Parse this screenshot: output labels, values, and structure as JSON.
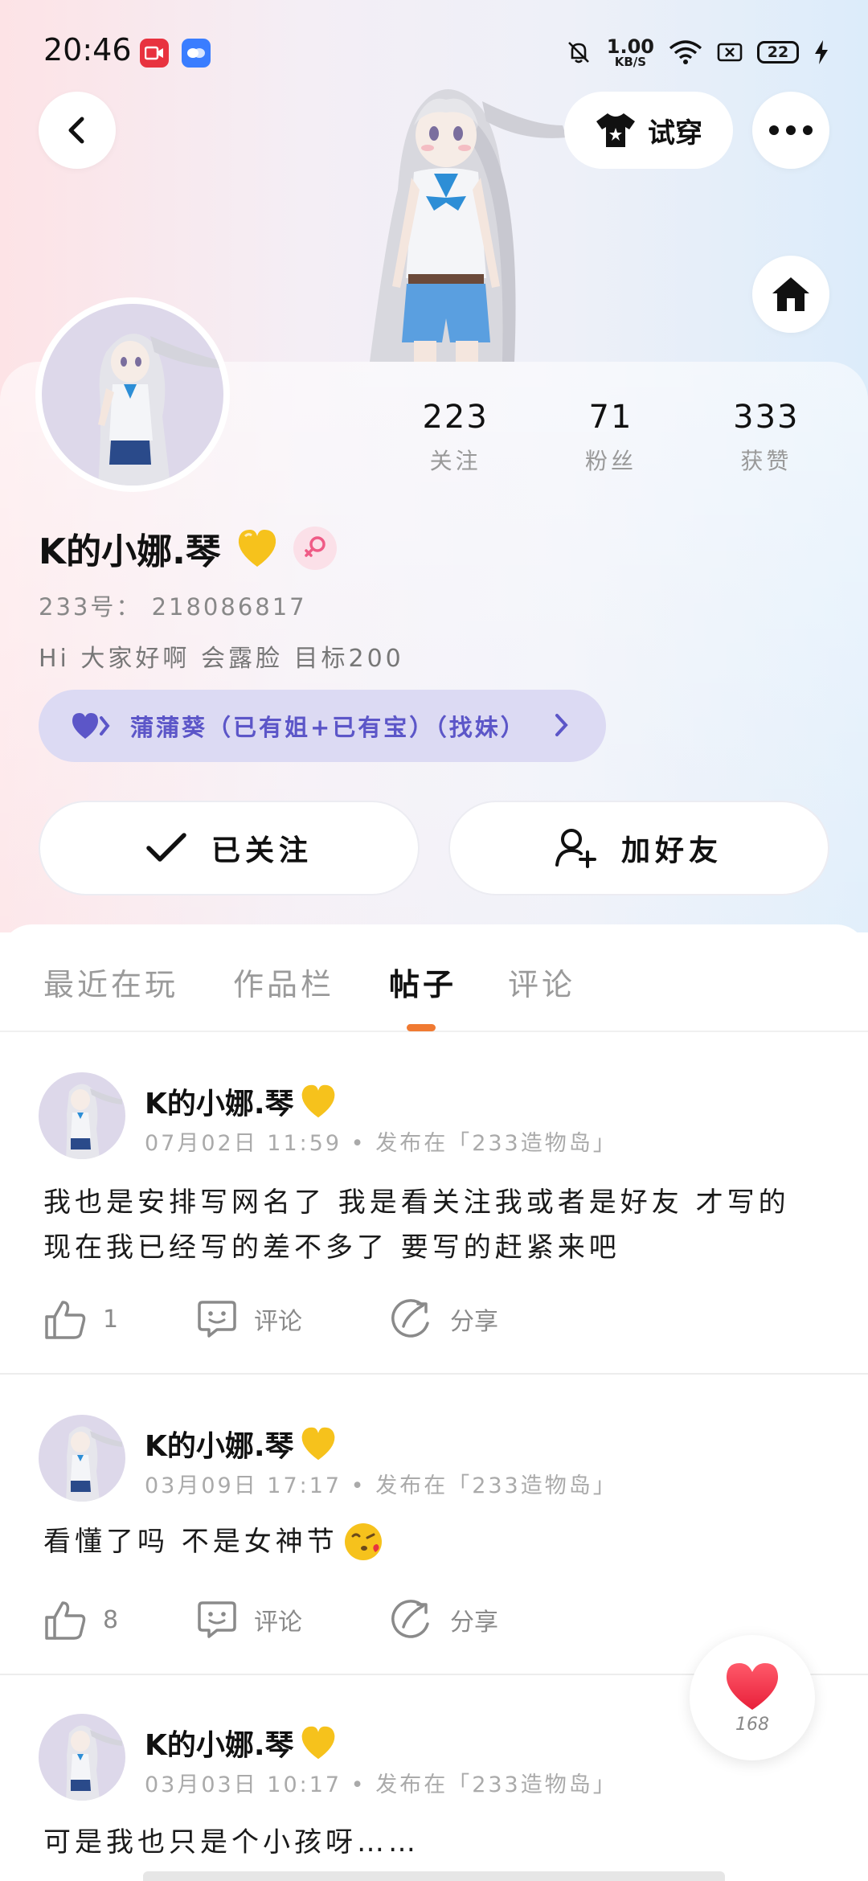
{
  "status_bar": {
    "time": "20:46",
    "net_speed_value": "1.00",
    "net_speed_unit": "KB/S",
    "battery": "22"
  },
  "header": {
    "try_on_label": "试穿"
  },
  "profile": {
    "name": "K的小娜.琴",
    "uid": "233号： 218086817",
    "bio": "Hi 大家好啊 会露脸 目标200",
    "tag": "蒲蒲葵（已有姐+已有宝）（找妹）"
  },
  "stats": [
    {
      "num": "223",
      "label": "关注"
    },
    {
      "num": "71",
      "label": "粉丝"
    },
    {
      "num": "333",
      "label": "获赞"
    }
  ],
  "actions": {
    "followed_label": "已关注",
    "add_friend_label": "加好友"
  },
  "tabs": [
    "最近在玩",
    "作品栏",
    "帖子",
    "评论"
  ],
  "posts": [
    {
      "author": "K的小娜.琴",
      "meta": "07月02日 11:59 • 发布在「233造物岛」",
      "text": "我也是安排写网名了 我是看关注我或者是好友 才写的 现在我已经写的差不多了 要写的赶紧来吧",
      "likes": "1",
      "comment_label": "评论",
      "share_label": "分享"
    },
    {
      "author": "K的小娜.琴",
      "meta": "03月09日 17:17 • 发布在「233造物岛」",
      "text": "看懂了吗 不是女神节",
      "likes": "8",
      "comment_label": "评论",
      "share_label": "分享"
    },
    {
      "author": "K的小娜.琴",
      "meta": "03月03日 10:17 • 发布在「233造物岛」",
      "text": "可是我也只是个小孩呀……"
    }
  ],
  "float_like": {
    "count": "168"
  },
  "colors": {
    "accent_orange": "#f07a32",
    "tag_purple": "#5c56c8",
    "tag_bg": "#dcdaf3",
    "heart_red": "#f0344a",
    "gender_pink": "#ef5b86"
  }
}
